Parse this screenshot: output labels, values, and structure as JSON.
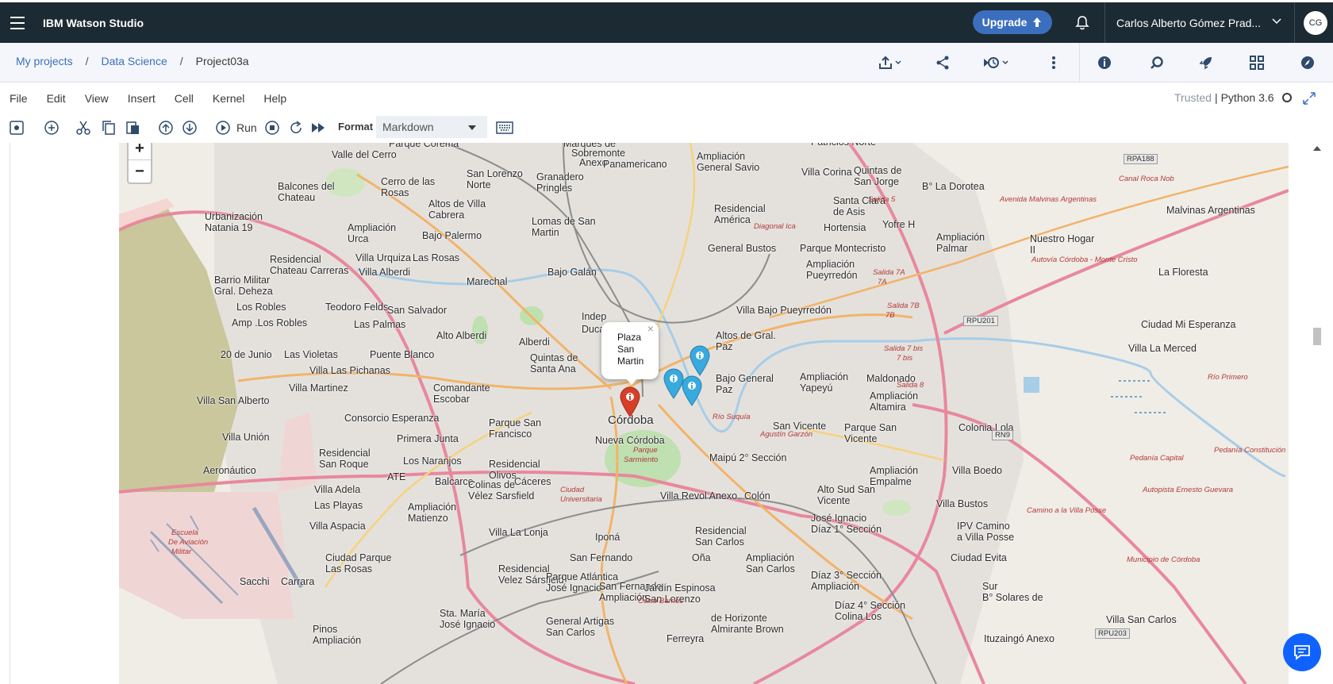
{
  "app": {
    "title": "IBM Watson Studio",
    "upgrade_label": "Upgrade",
    "user_name": "Carlos Alberto Gómez Prad...",
    "avatar_initials": "CG"
  },
  "breadcrumb": {
    "items": [
      "My projects",
      "Data Science"
    ],
    "separator": "/",
    "current": "Project03a"
  },
  "menu": {
    "items": [
      "File",
      "Edit",
      "View",
      "Insert",
      "Cell",
      "Kernel",
      "Help"
    ]
  },
  "kernel": {
    "trusted": "Trusted",
    "separator": "|",
    "name": "Python 3.6"
  },
  "toolbar": {
    "run_label": "Run",
    "format_label": "Format",
    "format_value": "Markdown"
  },
  "map": {
    "zoom_in": "+",
    "zoom_out": "−",
    "popup": {
      "line1": "Plaza",
      "line2": "San",
      "line3": "Martin",
      "close": "×"
    },
    "city": "Córdoba",
    "places": [
      "Marques de",
      "Sobremonte",
      "Anexo",
      "Parque Corema",
      "Valle del Cerro",
      "Panamericano",
      "Ampliación",
      "General Savio",
      "Villa Corina",
      "Quintas de",
      "San Jorge",
      "Patricios Norte",
      "B° La Dorotea",
      "Balcones del",
      "Chateau",
      "Cerro de las",
      "Rosas",
      "San Lorenzo",
      "Norte",
      "Granadero",
      "Pringles",
      "Santa Clara",
      "de Asis",
      "Urbanización",
      "Natania 19",
      "Altos de Villa",
      "Cabrera",
      "Lomas de San",
      "Martin",
      "Residencial",
      "América",
      "Hortensia",
      "Yofre H",
      "Ampliación",
      "Palmar",
      "Nuestro Hogar",
      "II",
      "Malvinas Argentinas",
      "Ampliación",
      "Urca",
      "Bajo Palermo",
      "Residencial",
      "Chateau Carreras",
      "Villa Urquiza",
      "Las Rosas",
      "General Bustos",
      "Parque Montecristo",
      "Ampliación",
      "Pueyrredón",
      "Villa Alberdi",
      "Barrio Militar",
      "Gral. Deheza",
      "Marechal",
      "Bajo Galán",
      "La Floresta",
      "Los Robles",
      "Teodoro Felds",
      "San Salvador",
      "Villa Bajo Pueyrredón",
      "Amp .Los Robles",
      "Las Palmas",
      "Ciudad Mi Esperanza",
      "Alto Alberdi",
      "Alberdi",
      "Indep",
      "Duca",
      "Altos de Gral.",
      "Paz",
      "20 de Junio",
      "Las Violetas",
      "Puente Blanco",
      "Quintas de",
      "Santa Ana",
      "Villa La Merced",
      "Villa Las Pichanas",
      "Bajo General",
      "Paz",
      "Ampliación",
      "Yapeyú",
      "Maldonado",
      "Villa Martinez",
      "Comandante",
      "Escobar",
      "Ampliación",
      "Altamira",
      "Villa San Alberto",
      "Consorcio Esperanza",
      "Parque San",
      "Francisco",
      "San Vicente",
      "Parque San",
      "Vicente",
      "Colonia Lola",
      "Villa Unión",
      "Primera Junta",
      "Nueva Córdoba",
      "Residencial",
      "San Roque",
      "Los Naranjos",
      "Residencial",
      "Olivos",
      "Maipú 2° Sección",
      "Aeronáutico",
      "ATE",
      "Balcarce",
      "Cáceres",
      "Ampliación",
      "Empalme",
      "Villa Boedo",
      "Villa Adela",
      "Colinas de",
      "Vélez Sarsfield",
      "Villa Revol Anexo",
      "Colón",
      "Alto Sud San",
      "Vicente",
      "Las Playas",
      "Ampliación",
      "Matienzo",
      "Villa Bustos",
      "Villa Aspacia",
      "Villa La Lonja",
      "Iponá",
      "José Ignacio",
      "Díaz 1° Sección",
      "IPV Camino",
      "a Villa Posse",
      "Residencial",
      "San Carlos",
      "Ciudad Parque",
      "Las Rosas",
      "San Fernando",
      "Oña",
      "Ampliación",
      "San Carlos",
      "Ciudad Evita",
      "Sacchi",
      "Carrara",
      "Residencial",
      "Velez Sársfield",
      "Parque Atlántica",
      "José Ignacio",
      "Díaz 3° Sección",
      "Ampliación",
      "San Fernando",
      "Ampliación",
      "Jardín Espinosa",
      "San Lorenzo",
      "Sur",
      "B° Solares de",
      "Sta. María",
      "José Ignacio",
      "Díaz 4° Sección",
      "Colina Los",
      "Pinos",
      "Ampliación",
      "General Artigas",
      "San Carlos",
      "de Horizonte",
      "Almirante Brown",
      "Villa San Carlos",
      "Ferreyra",
      "Ituzaingó Anexo"
    ],
    "shields": [
      "RPA188",
      "RPU201",
      "RN9",
      "RPU203"
    ],
    "road_labels": [
      "Salida 5",
      "Salida 7A",
      "7A",
      "Salida 7B",
      "7B",
      "Salida 7 bis",
      "7 bis",
      "Salida 8",
      "Avenida Malvinas Argentinas",
      "Autovía Córdoba - Monte Cristo",
      "Autopista Ernesto Guevara",
      "Camino a la Villa Posse",
      "Municipio de Córdoba",
      "Pedanía Capital",
      "Pedanía Constitución",
      "Escuela",
      "De Aviación",
      "Militar",
      "Parque",
      "Sarmiento",
      "Ciudad",
      "Universitaria",
      "Canal Roca Nob",
      "Río Suquía",
      "Agustín Garzón",
      "Celso Barrios",
      "Diagonal Ica",
      "Río Primero"
    ]
  },
  "colors": {
    "topbar": "#1b2a33",
    "accent": "#3b6fbd",
    "marker_red": "#d63e2a",
    "marker_blue": "#38aadd",
    "chat": "#0f62fe"
  }
}
